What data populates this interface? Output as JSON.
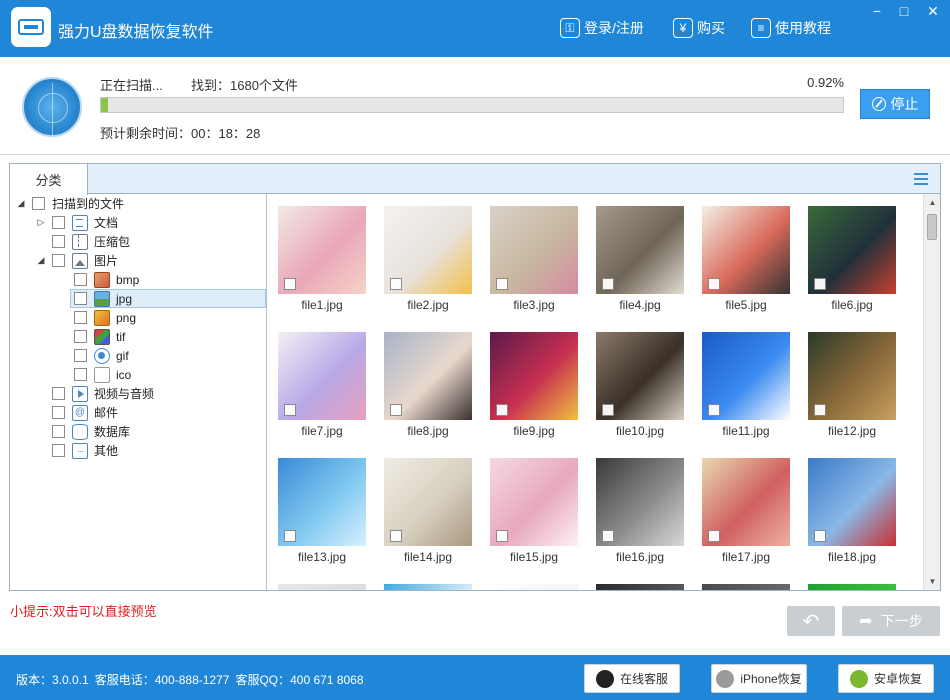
{
  "app": {
    "title": "强力U盘数据恢复软件",
    "actions": [
      {
        "label": "登录/注册",
        "icon": "user-key-icon"
      },
      {
        "label": "购买",
        "icon": "yen-icon"
      },
      {
        "label": "使用教程",
        "icon": "book-icon"
      }
    ],
    "window_controls": {
      "minimize": "−",
      "maximize": "□",
      "close": "✕"
    }
  },
  "scan": {
    "status": "正在扫描...",
    "found": "找到：1680个文件",
    "percent_text": "0.92%",
    "progress": 0.0092,
    "remaining": "预计剩余时间：00：18：28",
    "stop_label": "停止"
  },
  "tabs": {
    "category": "分类"
  },
  "tree": {
    "root": "扫描到的文件",
    "items": [
      {
        "label": "文档",
        "icon": "document-icon"
      },
      {
        "label": "压缩包",
        "icon": "archive-icon"
      },
      {
        "label": "图片",
        "icon": "image-icon",
        "children": [
          {
            "label": "bmp",
            "icon": "bmp-icon"
          },
          {
            "label": "jpg",
            "icon": "jpg-icon",
            "selected": true
          },
          {
            "label": "png",
            "icon": "png-icon"
          },
          {
            "label": "tif",
            "icon": "tif-icon"
          },
          {
            "label": "gif",
            "icon": "gif-icon"
          },
          {
            "label": "ico",
            "icon": "ico-icon"
          }
        ]
      },
      {
        "label": "视频与音频",
        "icon": "media-icon"
      },
      {
        "label": "邮件",
        "icon": "mail-icon"
      },
      {
        "label": "数据库",
        "icon": "database-icon"
      },
      {
        "label": "其他",
        "icon": "other-icon"
      }
    ]
  },
  "files": [
    {
      "name": "file1.jpg",
      "colors": [
        "#f3e9e6",
        "#e9a7b8",
        "#f6d3c7"
      ]
    },
    {
      "name": "file2.jpg",
      "colors": [
        "#f5f2f0",
        "#e8e2dc",
        "#f2c04a"
      ]
    },
    {
      "name": "file3.jpg",
      "colors": [
        "#d8d2c8",
        "#c9b8a0",
        "#d48aa0"
      ]
    },
    {
      "name": "file4.jpg",
      "colors": [
        "#a59a8c",
        "#6f6558",
        "#e2dcd2"
      ]
    },
    {
      "name": "file5.jpg",
      "colors": [
        "#f5f0e6",
        "#d86a5a",
        "#333333"
      ]
    },
    {
      "name": "file6.jpg",
      "colors": [
        "#3a6a3a",
        "#20303a",
        "#c84030"
      ]
    },
    {
      "name": "file7.jpg",
      "colors": [
        "#f4f0f4",
        "#b8a8e6",
        "#e8a0c0"
      ]
    },
    {
      "name": "file8.jpg",
      "colors": [
        "#a8b4c8",
        "#e8d8cc",
        "#3a3030"
      ]
    },
    {
      "name": "file9.jpg",
      "colors": [
        "#5a1a4a",
        "#c83050",
        "#f0c040"
      ]
    },
    {
      "name": "file10.jpg",
      "colors": [
        "#8a7a6a",
        "#3a3028",
        "#d8d0c4"
      ]
    },
    {
      "name": "file11.jpg",
      "colors": [
        "#1a5ac8",
        "#3a8af0",
        "#ffffff"
      ]
    },
    {
      "name": "file12.jpg",
      "colors": [
        "#2a3a2a",
        "#8a6a3a",
        "#c8a060"
      ]
    },
    {
      "name": "file13.jpg",
      "colors": [
        "#3a8ad8",
        "#80c8f0",
        "#d8f0ff"
      ]
    },
    {
      "name": "file14.jpg",
      "colors": [
        "#f0ece4",
        "#d8d0c0",
        "#a89880"
      ]
    },
    {
      "name": "file15.jpg",
      "colors": [
        "#f4d8e0",
        "#e8a8c0",
        "#fff0f4"
      ]
    },
    {
      "name": "file16.jpg",
      "colors": [
        "#3a3a3a",
        "#8a8a88",
        "#d8d8d6"
      ]
    },
    {
      "name": "file17.jpg",
      "colors": [
        "#e8d8b0",
        "#d06060",
        "#f0b0a0"
      ]
    },
    {
      "name": "file18.jpg",
      "colors": [
        "#3a7ac8",
        "#8ab8e8",
        "#c83030"
      ]
    },
    {
      "name": "",
      "colors": [
        "#e8e8e8",
        "#dcdcdc",
        "#f0f0f0"
      ]
    },
    {
      "name": "",
      "colors": [
        "#40a8e0",
        "#e0f0f8",
        "#f0f0f0"
      ]
    },
    {
      "name": "",
      "colors": [
        "#ffffff",
        "#f4f4f4",
        "#eeeeee"
      ]
    },
    {
      "name": "",
      "colors": [
        "#2a2a2a",
        "#5a5a5a",
        "#3a3a3a"
      ]
    },
    {
      "name": "",
      "colors": [
        "#4a4a4a",
        "#6a6a6a",
        "#3a3a3a"
      ]
    },
    {
      "name": "",
      "colors": [
        "#20a030",
        "#40c040",
        "#108020"
      ]
    }
  ],
  "footer": {
    "tip": "小提示:双击可以直接预览",
    "back_label": "↶",
    "next_label": "下一步",
    "version": "版本：3.0.0.1",
    "phone": "客服电话：400-888-1277",
    "qq": "客服QQ：400 671 8068",
    "buttons": [
      {
        "label": "在线客服",
        "icon": "qq-penguin-icon",
        "color": "#222222"
      },
      {
        "label": "iPhone恢复",
        "icon": "apple-icon",
        "color": "#9a9a9a"
      },
      {
        "label": "安卓恢复",
        "icon": "android-icon",
        "color": "#7ab830"
      }
    ]
  },
  "colors": {
    "primary": "#1f86d8",
    "accent": "#3a9ff0",
    "progress": "#8cc44a",
    "tip": "#e02020"
  }
}
